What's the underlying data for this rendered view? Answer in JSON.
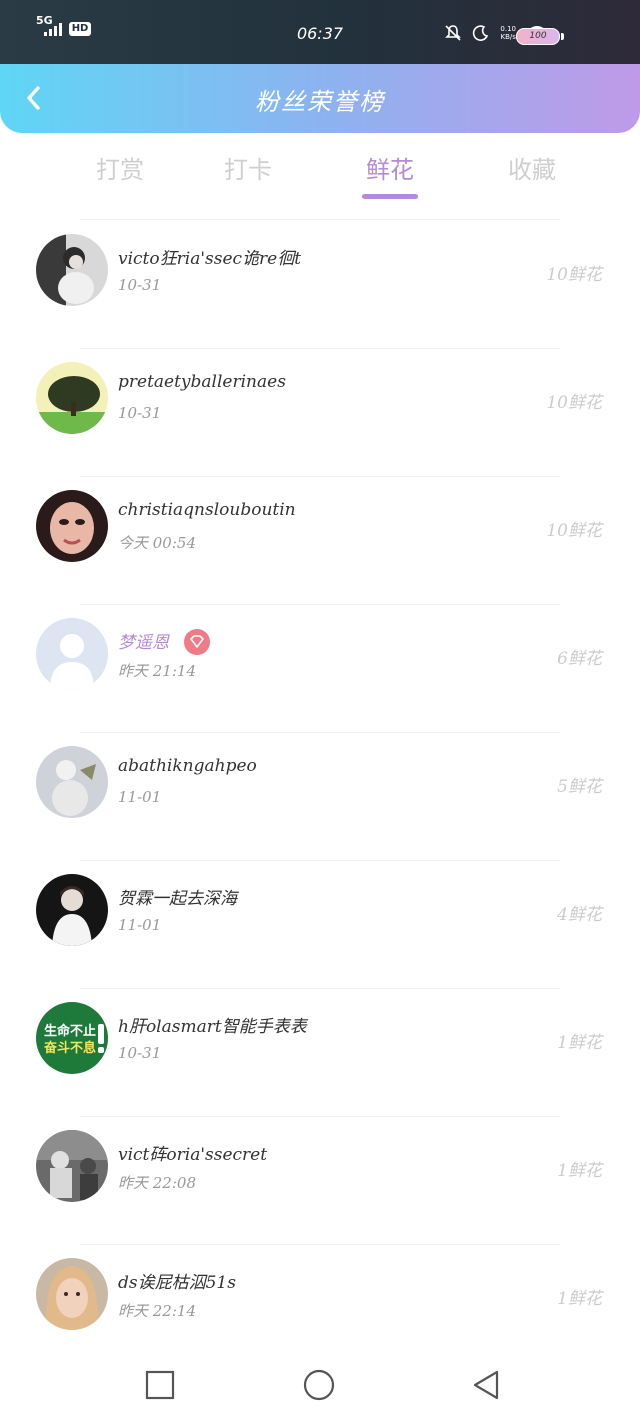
{
  "status_bar": {
    "network": "5G",
    "hd": "HD",
    "time": "06:37",
    "speed_value": "0.10",
    "speed_unit": "KB/s",
    "battery": "100"
  },
  "header": {
    "title": "粉丝荣誉榜",
    "back_icon": "chevron-left-icon"
  },
  "tabs": [
    {
      "label": "打赏",
      "active": false
    },
    {
      "label": "打卡",
      "active": false
    },
    {
      "label": "鲜花",
      "active": true
    },
    {
      "label": "收藏",
      "active": false
    }
  ],
  "colors": {
    "accent": "#b58ad8",
    "header_gradient_start": "#5fd6f5",
    "header_gradient_end": "#bf9ae8",
    "vip_badge": "#f07a86"
  },
  "fans": [
    {
      "name": "victo狂ria'ssec诡re徊t",
      "time": "10-31",
      "flowers": "10鲜花"
    },
    {
      "name": "pretaetyballerinaes",
      "time": "10-31",
      "flowers": "10鲜花"
    },
    {
      "name": "christiaqnslouboutin",
      "time": "今天 00:54",
      "flowers": "10鲜花"
    },
    {
      "name": "梦遥恩",
      "time": "昨天 21:14",
      "flowers": "6鲜花",
      "vip": true
    },
    {
      "name": "abathikngahpeo",
      "time": "11-01",
      "flowers": "5鲜花"
    },
    {
      "name": "贺霖一起去深海",
      "time": "11-01",
      "flowers": "4鲜花"
    },
    {
      "name": "h肝olasmart智能手表表",
      "time": "10-31",
      "flowers": "1鲜花"
    },
    {
      "name": "vict砗oria'ssecret",
      "time": "昨天 22:08",
      "flowers": "1鲜花"
    },
    {
      "name": "ds诶屁枯泅51s",
      "time": "昨天 22:14",
      "flowers": "1鲜花"
    }
  ],
  "avatar_texts": {
    "green_badge_line1": "生命不止",
    "green_badge_line2": "奋斗不息"
  },
  "navbar": {
    "square_icon": "recent-apps-icon",
    "circle_icon": "home-icon",
    "triangle_icon": "back-icon"
  }
}
